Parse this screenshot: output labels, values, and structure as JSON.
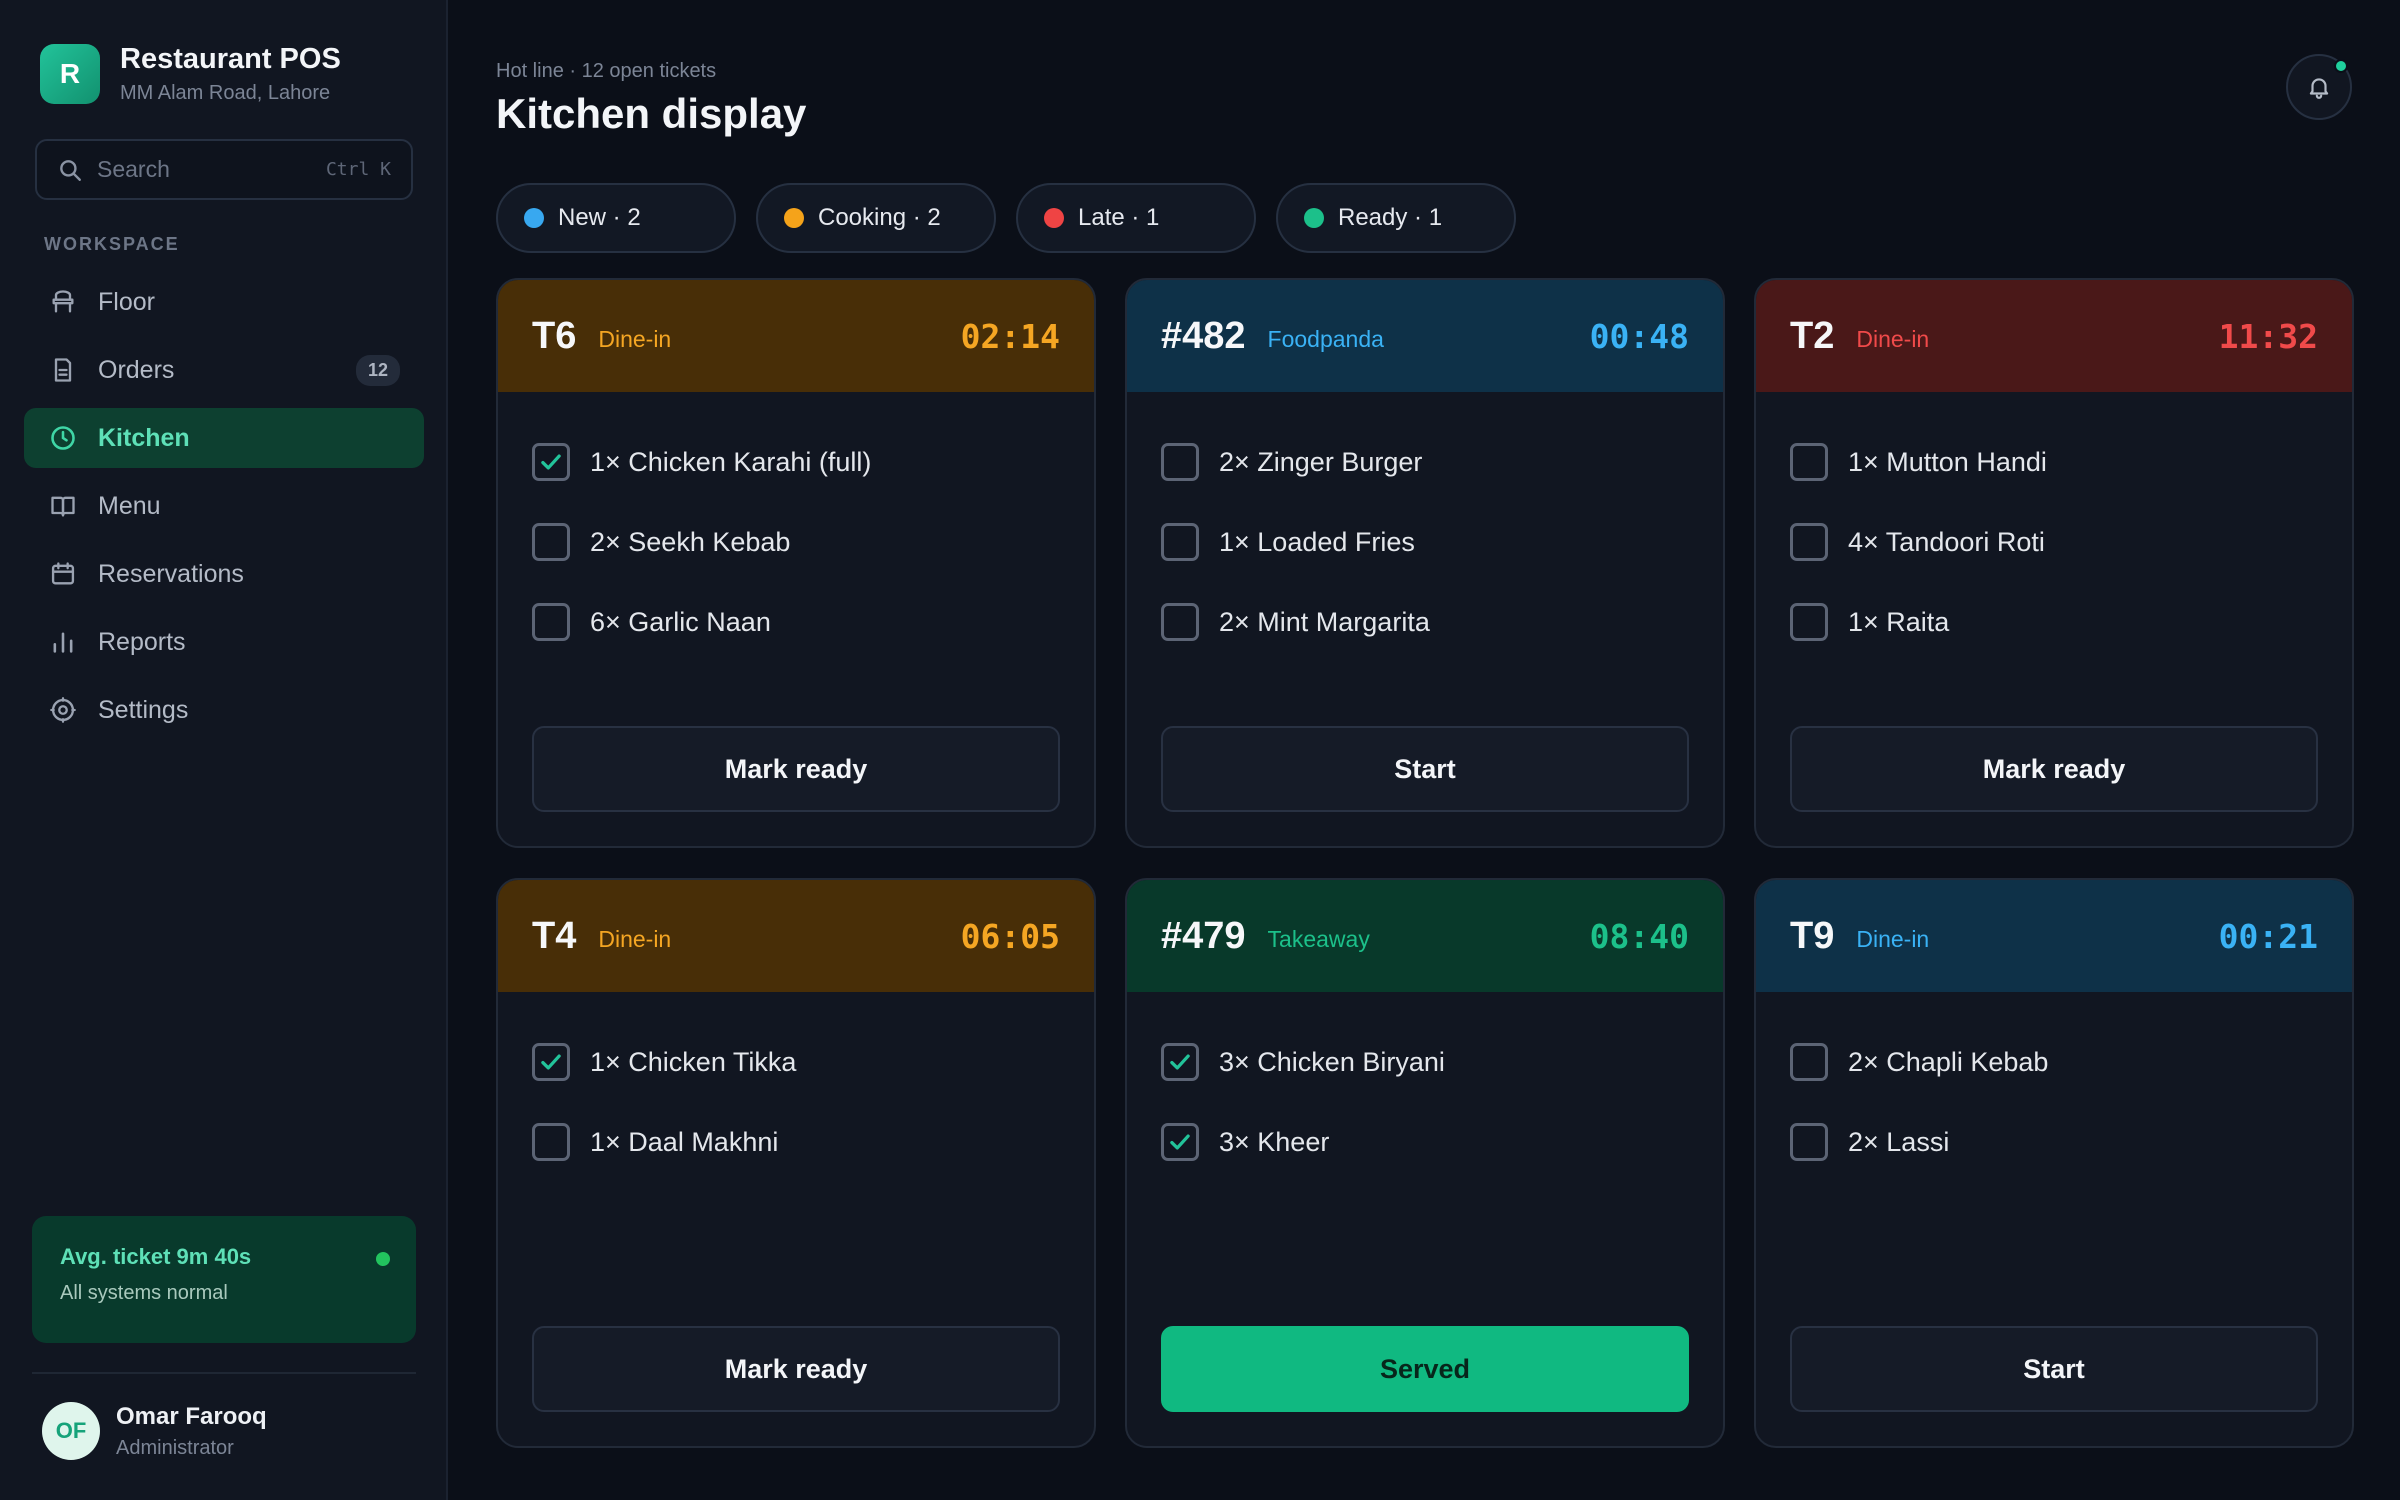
{
  "brand": {
    "logo": "R",
    "name": "Restaurant POS",
    "location": "MM Alam Road, Lahore"
  },
  "search": {
    "placeholder": "Search",
    "shortcut": "Ctrl K"
  },
  "sidebar": {
    "section_label": "WORKSPACE",
    "items": [
      {
        "label": "Floor",
        "icon": "chair-icon"
      },
      {
        "label": "Orders",
        "icon": "receipt-icon",
        "badge": "12"
      },
      {
        "label": "Kitchen",
        "icon": "clock-icon",
        "active": true
      },
      {
        "label": "Menu",
        "icon": "book-icon"
      },
      {
        "label": "Reservations",
        "icon": "calendar-icon"
      },
      {
        "label": "Reports",
        "icon": "bar-chart-icon"
      },
      {
        "label": "Settings",
        "icon": "gear-icon"
      }
    ],
    "status": {
      "title": "Avg. ticket 9m 40s",
      "subtitle": "All systems normal"
    },
    "user": {
      "initials": "OF",
      "name": "Omar Farooq",
      "role": "Administrator"
    }
  },
  "header": {
    "breadcrumb": "Hot line · 12 open tickets",
    "title": "Kitchen display"
  },
  "filters": [
    {
      "label": "New · 2",
      "color": "#38a8f0"
    },
    {
      "label": "Cooking · 2",
      "color": "#f5a31a"
    },
    {
      "label": "Late · 1",
      "color": "#ef4444"
    },
    {
      "label": "Ready · 1",
      "color": "#1cc08a"
    }
  ],
  "tickets": [
    {
      "id": "T6",
      "type": "Dine-in",
      "timer": "02:14",
      "status": "cooking",
      "header_bg": "#482e07",
      "accent": "#f5a623",
      "items": [
        {
          "text": "1× Chicken Karahi (full)",
          "done": true
        },
        {
          "text": "2× Seekh Kebab",
          "done": false
        },
        {
          "text": "6× Garlic Naan",
          "done": false
        }
      ],
      "action": "Mark ready",
      "primary": false
    },
    {
      "id": "#482",
      "type": "Foodpanda",
      "timer": "00:48",
      "status": "new",
      "header_bg": "#0e3148",
      "accent": "#3ab2f5",
      "items": [
        {
          "text": "2× Zinger Burger",
          "done": false
        },
        {
          "text": "1× Loaded Fries",
          "done": false
        },
        {
          "text": "2× Mint Margarita",
          "done": false
        }
      ],
      "action": "Start",
      "primary": false
    },
    {
      "id": "T2",
      "type": "Dine-in",
      "timer": "11:32",
      "status": "late",
      "header_bg": "#4a1818",
      "accent": "#f04a4a",
      "items": [
        {
          "text": "1× Mutton Handi",
          "done": false
        },
        {
          "text": "4× Tandoori Roti",
          "done": false
        },
        {
          "text": "1× Raita",
          "done": false
        }
      ],
      "action": "Mark ready",
      "primary": false
    },
    {
      "id": "T4",
      "type": "Dine-in",
      "timer": "06:05",
      "status": "cooking",
      "header_bg": "#482e07",
      "accent": "#f5a623",
      "items": [
        {
          "text": "1× Chicken Tikka",
          "done": true
        },
        {
          "text": "1× Daal Makhni",
          "done": false
        }
      ],
      "action": "Mark ready",
      "primary": false
    },
    {
      "id": "#479",
      "type": "Takeaway",
      "timer": "08:40",
      "status": "ready",
      "header_bg": "#08392a",
      "accent": "#1cc08a",
      "items": [
        {
          "text": "3× Chicken Biryani",
          "done": true
        },
        {
          "text": "3× Kheer",
          "done": true
        }
      ],
      "action": "Served",
      "primary": true
    },
    {
      "id": "T9",
      "type": "Dine-in",
      "timer": "00:21",
      "status": "new",
      "header_bg": "#0e3148",
      "accent": "#3ab2f5",
      "items": [
        {
          "text": "2× Chapli Kebab",
          "done": false
        },
        {
          "text": "2× Lassi",
          "done": false
        }
      ],
      "action": "Start",
      "primary": false
    }
  ]
}
